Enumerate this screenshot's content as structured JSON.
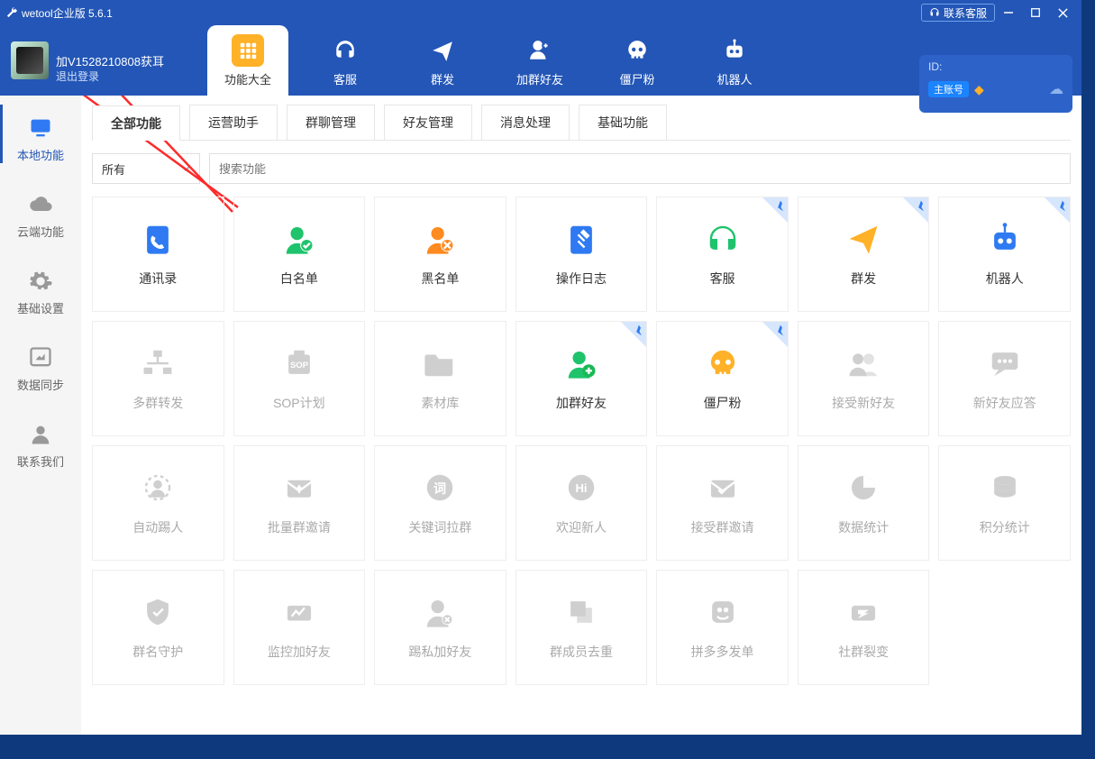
{
  "title": {
    "app": "wetool企业版",
    "version": "5.6.1"
  },
  "contact_label": "联系客服",
  "user": {
    "name": "加V1528210808获耳",
    "logout": "退出登录"
  },
  "id_box": {
    "label": "ID:",
    "badge": "主账号"
  },
  "nav": [
    {
      "label": "功能大全"
    },
    {
      "label": "客服"
    },
    {
      "label": "群发"
    },
    {
      "label": "加群好友"
    },
    {
      "label": "僵尸粉"
    },
    {
      "label": "机器人"
    }
  ],
  "sidebar": [
    {
      "label": "本地功能"
    },
    {
      "label": "云端功能"
    },
    {
      "label": "基础设置"
    },
    {
      "label": "数据同步"
    },
    {
      "label": "联系我们"
    }
  ],
  "tabs": [
    {
      "label": "全部功能"
    },
    {
      "label": "运营助手"
    },
    {
      "label": "群聊管理"
    },
    {
      "label": "好友管理"
    },
    {
      "label": "消息处理"
    },
    {
      "label": "基础功能"
    }
  ],
  "filter": {
    "all": "所有"
  },
  "search": {
    "placeholder": "搜索功能"
  },
  "cards": [
    {
      "label": "通讯录",
      "color": "#2f7af2",
      "icon": "phone",
      "pinned": false,
      "dim": false
    },
    {
      "label": "白名单",
      "color": "#1ec36b",
      "icon": "user-check",
      "pinned": false,
      "dim": false
    },
    {
      "label": "黑名单",
      "color": "#ff8a1f",
      "icon": "user-block",
      "pinned": false,
      "dim": false
    },
    {
      "label": "操作日志",
      "color": "#2f7af2",
      "icon": "log",
      "pinned": false,
      "dim": false
    },
    {
      "label": "客服",
      "color": "#1ec36b",
      "icon": "headset",
      "pinned": true,
      "dim": false
    },
    {
      "label": "群发",
      "color": "#ffb127",
      "icon": "send",
      "pinned": true,
      "dim": false
    },
    {
      "label": "机器人",
      "color": "#2f7af2",
      "icon": "robot",
      "pinned": true,
      "dim": false
    },
    {
      "label": "多群转发",
      "color": "#ccc",
      "icon": "forward",
      "pinned": false,
      "dim": true
    },
    {
      "label": "SOP计划",
      "color": "#ccc",
      "icon": "sop",
      "pinned": false,
      "dim": true
    },
    {
      "label": "素材库",
      "color": "#ccc",
      "icon": "folder",
      "pinned": false,
      "dim": true
    },
    {
      "label": "加群好友",
      "color": "#1ec36b",
      "icon": "user-plus",
      "pinned": true,
      "dim": false
    },
    {
      "label": "僵尸粉",
      "color": "#ffb127",
      "icon": "skull",
      "pinned": true,
      "dim": false
    },
    {
      "label": "接受新好友",
      "color": "#ccc",
      "icon": "users",
      "pinned": false,
      "dim": true
    },
    {
      "label": "新好友应答",
      "color": "#ccc",
      "icon": "chat",
      "pinned": false,
      "dim": true
    },
    {
      "label": "自动踢人",
      "color": "#ccc",
      "icon": "kick",
      "pinned": false,
      "dim": true
    },
    {
      "label": "批量群邀请",
      "color": "#ccc",
      "icon": "envelope",
      "pinned": false,
      "dim": true
    },
    {
      "label": "关键词拉群",
      "color": "#ccc",
      "icon": "keyword",
      "pinned": false,
      "dim": true
    },
    {
      "label": "欢迎新人",
      "color": "#ccc",
      "icon": "hi",
      "pinned": false,
      "dim": true
    },
    {
      "label": "接受群邀请",
      "color": "#ccc",
      "icon": "env-check",
      "pinned": false,
      "dim": true
    },
    {
      "label": "数据统计",
      "color": "#ccc",
      "icon": "pie",
      "pinned": false,
      "dim": true
    },
    {
      "label": "积分统计",
      "color": "#ccc",
      "icon": "stack",
      "pinned": false,
      "dim": true
    },
    {
      "label": "群名守护",
      "color": "#ccc",
      "icon": "shield",
      "pinned": false,
      "dim": true
    },
    {
      "label": "监控加好友",
      "color": "#ccc",
      "icon": "monitor",
      "pinned": false,
      "dim": true
    },
    {
      "label": "踢私加好友",
      "color": "#ccc",
      "icon": "user-x",
      "pinned": false,
      "dim": true
    },
    {
      "label": "群成员去重",
      "color": "#ccc",
      "icon": "dedup",
      "pinned": false,
      "dim": true
    },
    {
      "label": "拼多多发单",
      "color": "#ccc",
      "icon": "pdd",
      "pinned": false,
      "dim": true
    },
    {
      "label": "社群裂变",
      "color": "#ccc",
      "icon": "split",
      "pinned": false,
      "dim": true
    }
  ]
}
